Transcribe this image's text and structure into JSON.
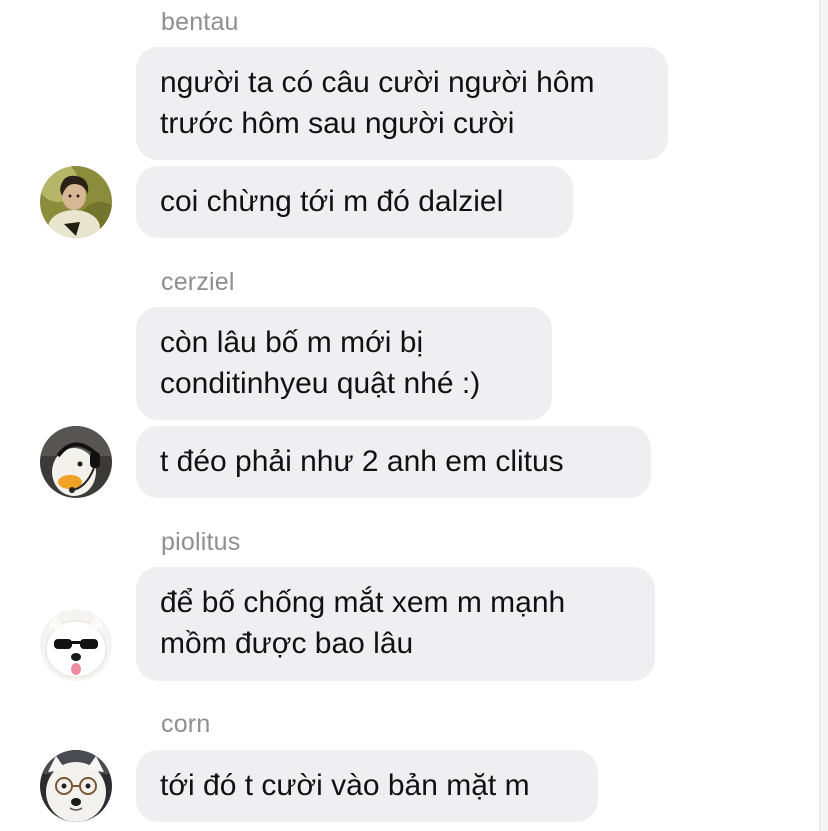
{
  "groups": [
    {
      "sender": "bentau",
      "avatar_icon": "person-photo-avatar-icon",
      "messages": [
        "người ta có câu cười người hôm\ntrước hôm sau người cười",
        "coi chừng tới m đó dalziel"
      ]
    },
    {
      "sender": "cerziel",
      "avatar_icon": "duck-headset-avatar-icon",
      "messages": [
        "còn lâu bố m mới bị\nconditinhyeu quật nhé :)",
        "t đéo phải như 2 anh em clitus"
      ]
    },
    {
      "sender": "piolitus",
      "avatar_icon": "dog-sunglasses-avatar-icon",
      "messages": [
        "để bố chống mắt xem m mạnh\nmồm được bao lâu"
      ]
    },
    {
      "sender": "corn",
      "avatar_icon": "dog-glasses-avatar-icon",
      "messages": [
        "tới đó t cười vào bản mặt m"
      ]
    }
  ],
  "colors": {
    "bubble": "#efeff2",
    "sender_name": "#8e8e93",
    "text": "#111111"
  }
}
